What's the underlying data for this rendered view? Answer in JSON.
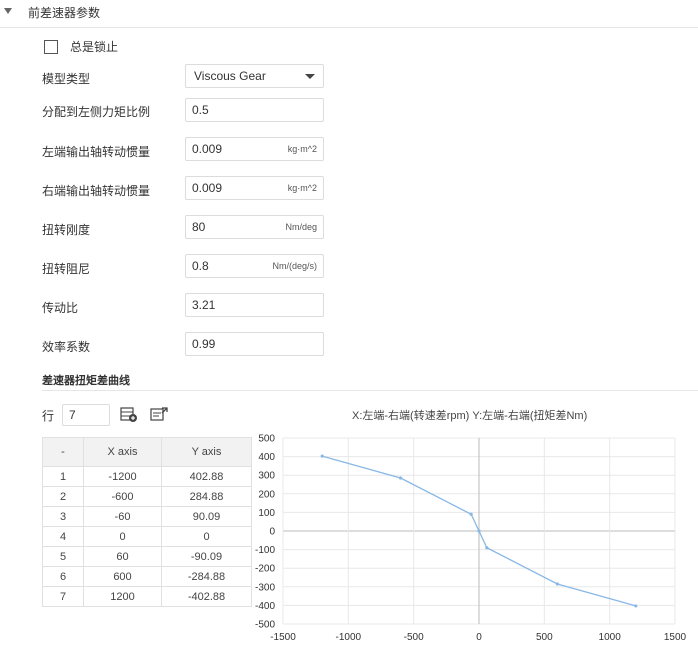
{
  "section": {
    "title": "前差速器参数"
  },
  "lock": {
    "label": "总是锁止",
    "checked": false
  },
  "params": [
    {
      "label": "模型类型",
      "value": "Viscous Gear",
      "unit": "",
      "type": "select"
    },
    {
      "label": "分配到左侧力矩比例",
      "value": "0.5",
      "unit": "",
      "type": "input"
    },
    {
      "label": "左端输出轴转动惯量",
      "value": "0.009",
      "unit": "kg·m^2",
      "type": "input"
    },
    {
      "label": "右端输出轴转动惯量",
      "value": "0.009",
      "unit": "kg·m^2",
      "type": "input"
    },
    {
      "label": "扭转刚度",
      "value": "80",
      "unit": "Nm/deg",
      "type": "input"
    },
    {
      "label": "扭转阻尼",
      "value": "0.8",
      "unit": "Nm/(deg/s)",
      "type": "input"
    },
    {
      "label": "传动比",
      "value": "3.21",
      "unit": "",
      "type": "input"
    },
    {
      "label": "效率系数",
      "value": "0.99",
      "unit": "",
      "type": "input"
    }
  ],
  "curve": {
    "title": "差速器扭矩差曲线",
    "rows_label": "行",
    "rows_value": "7",
    "table": {
      "headers": [
        "-",
        "X axis",
        "Y axis"
      ],
      "rows": [
        [
          "1",
          "-1200",
          "402.88"
        ],
        [
          "2",
          "-600",
          "284.88"
        ],
        [
          "3",
          "-60",
          "90.09"
        ],
        [
          "4",
          "0",
          "0"
        ],
        [
          "5",
          "60",
          "-90.09"
        ],
        [
          "6",
          "600",
          "-284.88"
        ],
        [
          "7",
          "1200",
          "-402.88"
        ]
      ]
    }
  },
  "chart_data": {
    "type": "line",
    "title": "X:左端-右端(转速差rpm) Y:左端-右端(扭矩差Nm)",
    "x": [
      -1200,
      -600,
      -60,
      0,
      60,
      600,
      1200
    ],
    "series": [
      {
        "values": [
          402.88,
          284.88,
          90.09,
          0,
          -90.09,
          -284.88,
          -402.88
        ]
      }
    ],
    "xlim": [
      -1500,
      1500
    ],
    "ylim": [
      -500,
      500
    ],
    "xticks": [
      -1500,
      -1000,
      -500,
      0,
      500,
      1000,
      1500
    ],
    "yticks": [
      500,
      400,
      300,
      200,
      100,
      0,
      -100,
      -200,
      -300,
      -400,
      -500
    ],
    "grid": true,
    "color": "#8ab8e6"
  }
}
